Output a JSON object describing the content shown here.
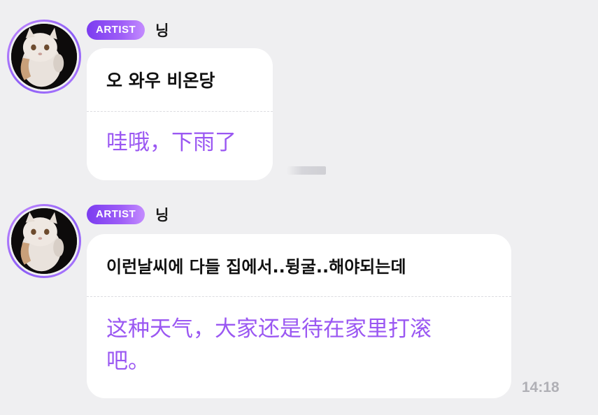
{
  "colors": {
    "background": "#efeff1",
    "bubble": "#ffffff",
    "badge_gradient_start": "#7b3cf0",
    "badge_gradient_end": "#c48cff",
    "translation_text": "#9a57f2",
    "timestamp_text": "#b0b0b6"
  },
  "messages": [
    {
      "badge": "ARTIST",
      "sender": "닝",
      "avatar_icon": "white-cat-avatar-icon",
      "original": "오 와우 비온당",
      "translation": "哇哦，下雨了"
    },
    {
      "badge": "ARTIST",
      "sender": "닝",
      "avatar_icon": "white-cat-avatar-icon",
      "original": "이런날씨에 다들 집에서..뒹굴..해야되는데",
      "translation": "这种天气，大家还是待在家里打滚吧。",
      "time": "14:18"
    }
  ]
}
